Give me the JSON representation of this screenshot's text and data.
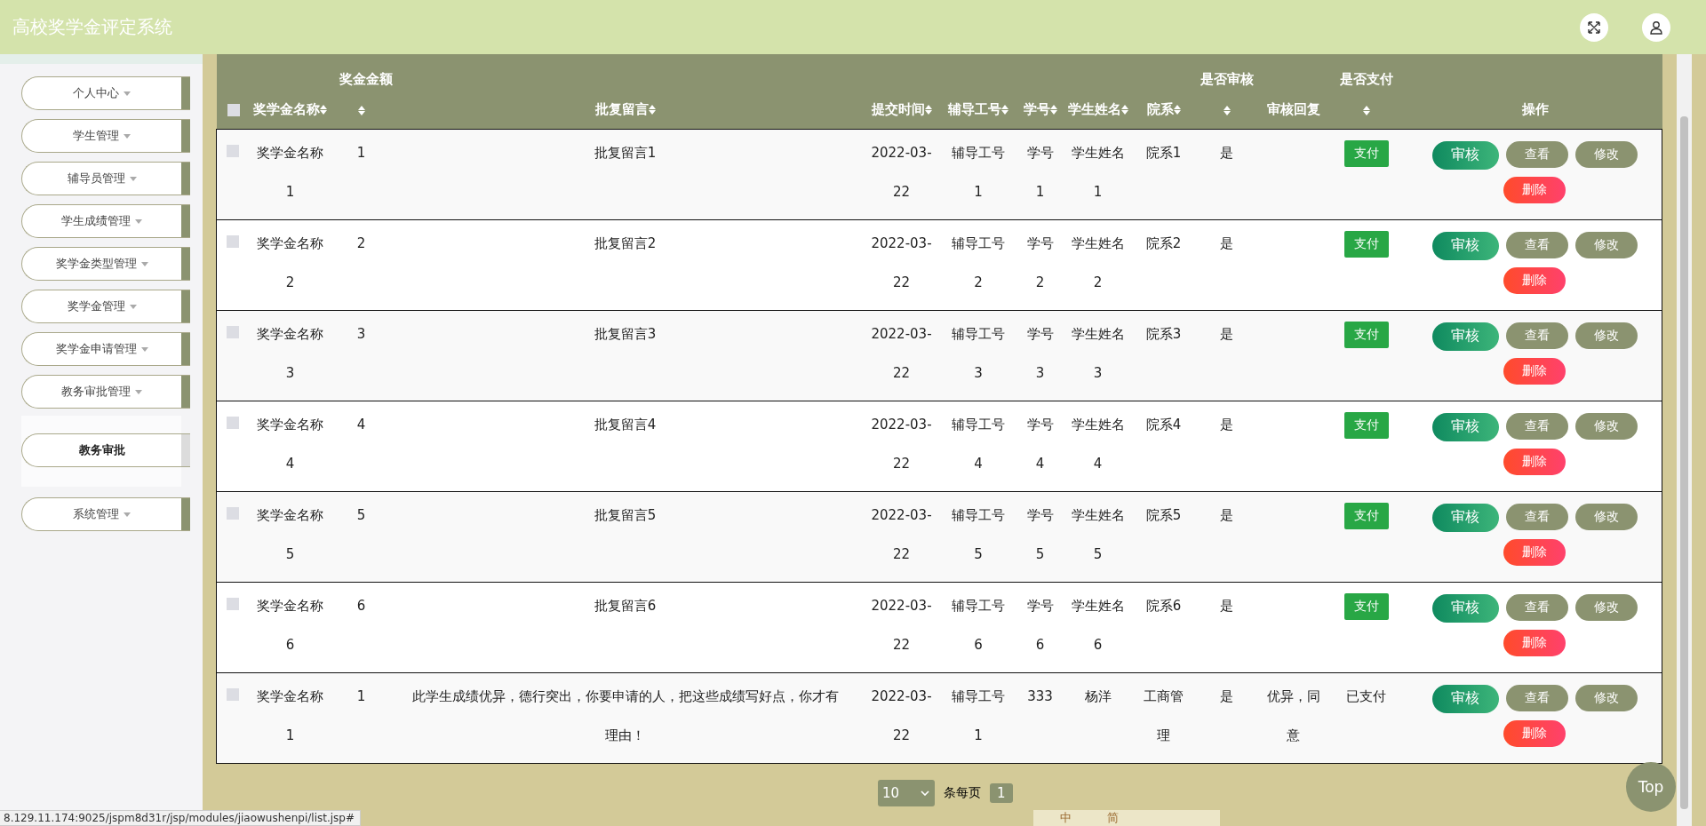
{
  "header": {
    "title": "高校奖学金评定系统"
  },
  "sidebar": {
    "items": [
      {
        "label": "个人中心"
      },
      {
        "label": "学生管理"
      },
      {
        "label": "辅导员管理"
      },
      {
        "label": "学生成绩管理"
      },
      {
        "label": "奖学金类型管理"
      },
      {
        "label": "奖学金管理"
      },
      {
        "label": "奖学金申请管理"
      },
      {
        "label": "教务审批管理",
        "children": [
          {
            "label": "教务审批",
            "selected": true
          }
        ]
      },
      {
        "label": "系统管理"
      }
    ]
  },
  "table": {
    "select_all_checked": false,
    "columns": [
      {
        "label": "奖学金名称",
        "kind": "inline",
        "sortable": true
      },
      {
        "label": "奖金金额",
        "kind": "stacked",
        "sortable": true
      },
      {
        "label": "批复留言",
        "kind": "inline",
        "sortable": true
      },
      {
        "label": "提交时间",
        "kind": "inline",
        "sortable": true
      },
      {
        "label": "辅导工号",
        "kind": "inline",
        "sortable": true
      },
      {
        "label": "学号",
        "kind": "inline",
        "sortable": true
      },
      {
        "label": "学生姓名",
        "kind": "inline",
        "sortable": true
      },
      {
        "label": "院系",
        "kind": "inline",
        "sortable": true
      },
      {
        "label": "是否审核",
        "kind": "stacked",
        "sortable": true
      },
      {
        "label": "审核回复",
        "kind": "inline",
        "sortable": false
      },
      {
        "label": "是否支付",
        "kind": "stacked",
        "sortable": true
      },
      {
        "label": "操作",
        "kind": "inline",
        "sortable": false
      }
    ],
    "rows": [
      {
        "checked": false,
        "cells": [
          "奖学金名称1",
          "1",
          "批复留言1",
          "2022-03-22",
          "辅导工号1",
          "学号1",
          "学生姓名1",
          "院系1",
          "是",
          ""
        ],
        "pay": {
          "kind": "button",
          "label": "支付"
        },
        "actions": [
          "审核",
          "查看",
          "修改",
          "删除"
        ]
      },
      {
        "checked": false,
        "cells": [
          "奖学金名称2",
          "2",
          "批复留言2",
          "2022-03-22",
          "辅导工号2",
          "学号2",
          "学生姓名2",
          "院系2",
          "是",
          ""
        ],
        "pay": {
          "kind": "button",
          "label": "支付"
        },
        "actions": [
          "审核",
          "查看",
          "修改",
          "删除"
        ]
      },
      {
        "checked": false,
        "cells": [
          "奖学金名称3",
          "3",
          "批复留言3",
          "2022-03-22",
          "辅导工号3",
          "学号3",
          "学生姓名3",
          "院系3",
          "是",
          ""
        ],
        "pay": {
          "kind": "button",
          "label": "支付"
        },
        "actions": [
          "审核",
          "查看",
          "修改",
          "删除"
        ]
      },
      {
        "checked": false,
        "cells": [
          "奖学金名称4",
          "4",
          "批复留言4",
          "2022-03-22",
          "辅导工号4",
          "学号4",
          "学生姓名4",
          "院系4",
          "是",
          ""
        ],
        "pay": {
          "kind": "button",
          "label": "支付"
        },
        "actions": [
          "审核",
          "查看",
          "修改",
          "删除"
        ]
      },
      {
        "checked": false,
        "cells": [
          "奖学金名称5",
          "5",
          "批复留言5",
          "2022-03-22",
          "辅导工号5",
          "学号5",
          "学生姓名5",
          "院系5",
          "是",
          ""
        ],
        "pay": {
          "kind": "button",
          "label": "支付"
        },
        "actions": [
          "审核",
          "查看",
          "修改",
          "删除"
        ]
      },
      {
        "checked": false,
        "cells": [
          "奖学金名称6",
          "6",
          "批复留言6",
          "2022-03-22",
          "辅导工号6",
          "学号6",
          "学生姓名6",
          "院系6",
          "是",
          ""
        ],
        "pay": {
          "kind": "button",
          "label": "支付"
        },
        "actions": [
          "审核",
          "查看",
          "修改",
          "删除"
        ]
      },
      {
        "checked": false,
        "cells": [
          "奖学金名称1",
          "1",
          "此学生成绩优异，德行突出，你要申请的人，把这些成绩写好点，你才有理由！",
          "2022-03-22",
          "辅导工号1",
          "333",
          "杨洋",
          "工商管理",
          "是",
          "优异，同意"
        ],
        "pay": {
          "kind": "text",
          "label": "已支付"
        },
        "actions": [
          "审核",
          "查看",
          "修改",
          "删除"
        ]
      }
    ]
  },
  "pagination": {
    "page_size": "10",
    "per_page_label": "条每页",
    "pages": [
      {
        "label": "1",
        "selected": true
      }
    ]
  },
  "top_button": "Top",
  "ime_bar": [
    "中",
    "简"
  ],
  "status_url": "8.129.11.174:9025/jspm8d31r/jsp/modules/jiaowushenpi/list.jsp#"
}
